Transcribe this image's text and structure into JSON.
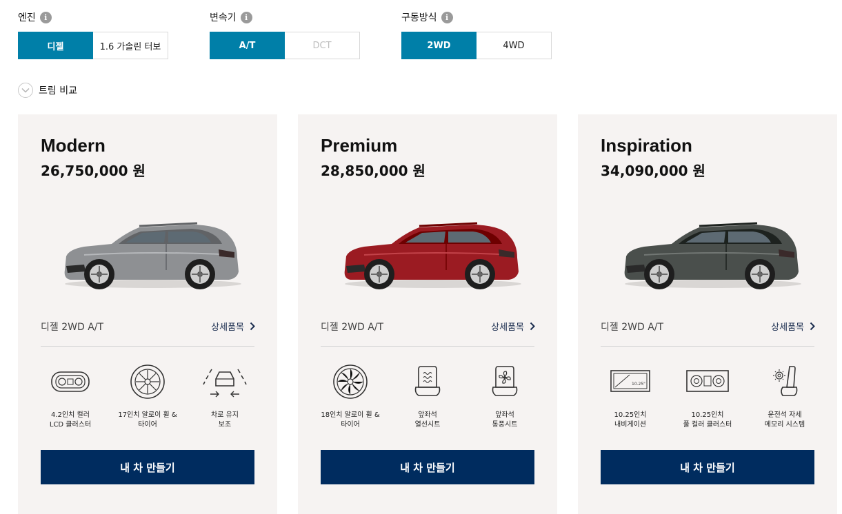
{
  "filters": {
    "engine": {
      "label": "엔진",
      "options": [
        "디젤",
        "1.6 가솔린 터보"
      ],
      "selected": "디젤"
    },
    "transmission": {
      "label": "변속기",
      "options": [
        "A/T",
        "DCT"
      ],
      "selected": "A/T"
    },
    "drive": {
      "label": "구동방식",
      "options": [
        "2WD",
        "4WD"
      ],
      "selected": "2WD"
    }
  },
  "compare_label": "트림 비교",
  "cards": [
    {
      "name": "Modern",
      "price": "26,750,000 원",
      "car_color": "#8e9093",
      "spec": "디젤 2WD A/T",
      "detail_label": "상세품목",
      "features": [
        {
          "icon": "lcd-cluster-icon",
          "label": "4.2인치 컬러\nLCD 클러스터"
        },
        {
          "icon": "alloy-wheel-17-icon",
          "label": "17인치 알로이 휠 &\n타이어"
        },
        {
          "icon": "lane-keeping-assist-icon",
          "label": "차로 유지\n보조"
        }
      ],
      "build_label": "내 차 만들기"
    },
    {
      "name": "Premium",
      "price": "28,850,000 원",
      "car_color": "#9b1b22",
      "spec": "디젤 2WD A/T",
      "detail_label": "상세품목",
      "features": [
        {
          "icon": "alloy-wheel-18-icon",
          "label": "18인치 알로이 휠 &\n타이어"
        },
        {
          "icon": "heated-seat-icon",
          "label": "앞좌석\n열선시트"
        },
        {
          "icon": "ventilated-seat-icon",
          "label": "앞좌석\n통풍시트"
        }
      ],
      "build_label": "내 차 만들기"
    },
    {
      "name": "Inspiration",
      "price": "34,090,000 원",
      "car_color": "#4a4f4c",
      "spec": "디젤 2WD A/T",
      "detail_label": "상세품목",
      "features": [
        {
          "icon": "navigation-icon",
          "label": "10.25인치\n내비게이션"
        },
        {
          "icon": "full-color-cluster-icon",
          "label": "10.25인치\n풀 컬러 클러스터"
        },
        {
          "icon": "driver-seat-memory-icon",
          "label": "운전석 자세\n메모리 시스템"
        }
      ],
      "build_label": "내 차 만들기"
    }
  ],
  "colors": {
    "accent": "#007fa8",
    "navy": "#002c5f",
    "card_bg": "#f6f3f2"
  },
  "icons": {
    "info": "i",
    "nav_screen_text": "10.25\""
  }
}
